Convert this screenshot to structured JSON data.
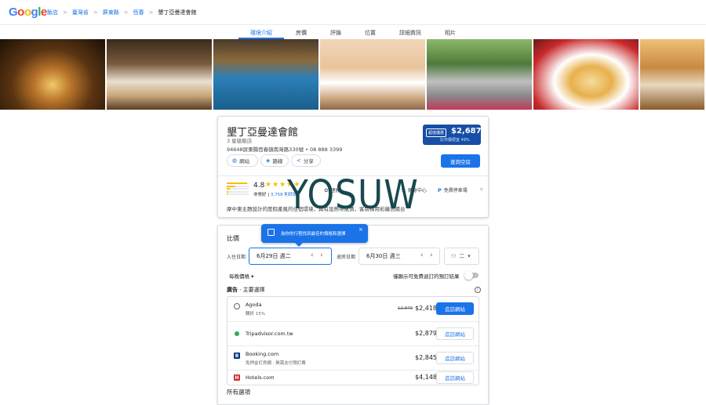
{
  "logo": [
    "G",
    "o",
    "o",
    "g",
    "l",
    "e"
  ],
  "breadcrumb": {
    "items": [
      "飯店",
      "臺灣省",
      "屏東縣",
      "恆春"
    ],
    "current": "墾丁亞曼達會館",
    "separator": ">"
  },
  "tabs": [
    "環境介紹",
    "房價",
    "評論",
    "位置",
    "詳細資訊",
    "相片"
  ],
  "active_tab": "環境介紹",
  "hotel": {
    "name": "墾丁亞曼達會館",
    "stars": "3 星級飯店",
    "address": "94648屏東縣恆春鎮南灣路330號 • 08 888 3399",
    "actions": {
      "website": "網站",
      "directions": "路線",
      "share": "分享"
    },
    "price_badge": {
      "tag": "超值優惠",
      "price": "$2,687",
      "sub": "比市價便宜 49%"
    },
    "book_label": "查詢空房",
    "rating": {
      "score": "4.8",
      "stars": "★★★★★",
      "label": "非常好",
      "count": "3,758 則評論"
    },
    "amenities": [
      {
        "icon": "spa-icon",
        "label": "理療"
      },
      {
        "icon": "fitness-icon",
        "label": "健身中心"
      },
      {
        "icon": "parking-icon",
        "label": "免費停車場"
      }
    ],
    "description": "摩中東主題設計的度假產風的住宿環境，具有設熱帶風情，客房採用彩繪流陽台"
  },
  "watermark": "YOSUW",
  "compare": {
    "title": "比價",
    "tooltip": "為你的行程找到最佳的價格和選擇",
    "checkin_label": "入住日期",
    "checkin_value": "6月29日 週二",
    "checkout_label": "退房日期",
    "checkout_value": "6月30日 週三",
    "guests": "二",
    "per_night": "每晚價格",
    "free_cancel": "僅顯示可免費退訂的預訂結果",
    "ads_prefix": "廣告",
    "ads_title": " · 主要選擇",
    "all_options": "所有選項"
  },
  "offers": [
    {
      "name": "Agoda",
      "sub": "購折 15%",
      "strike": "$2,879",
      "price": "$2,418",
      "button": "造訪網站",
      "primary": true,
      "logo_color": "#ffffff",
      "logo_text_color": "#5f6368",
      "logo_char": "○"
    },
    {
      "name": "Tripadvisor.com.tw",
      "sub": "",
      "strike": "",
      "price": "$2,879",
      "button": "造訪網站",
      "primary": false,
      "logo_color": "#34a853",
      "logo_text_color": "#ffffff",
      "logo_char": "●"
    },
    {
      "name": "Booking.com",
      "sub": "免押金訂房網 · 無需支付預訂費",
      "strike": "",
      "price": "$2,845",
      "button": "造訪網站",
      "primary": false,
      "logo_color": "#003580",
      "logo_text_color": "#ffffff",
      "logo_char": "B"
    },
    {
      "name": "Hotels.com",
      "sub": "",
      "strike": "",
      "price": "$4,148",
      "button": "造訪網站",
      "primary": false,
      "logo_color": "#d32f2f",
      "logo_text_color": "#ffffff",
      "logo_char": "H"
    }
  ],
  "colors": {
    "accent": "#1a73e8",
    "badge": "#174ea6",
    "star": "#fbbc05",
    "watermark": "#17494f"
  }
}
